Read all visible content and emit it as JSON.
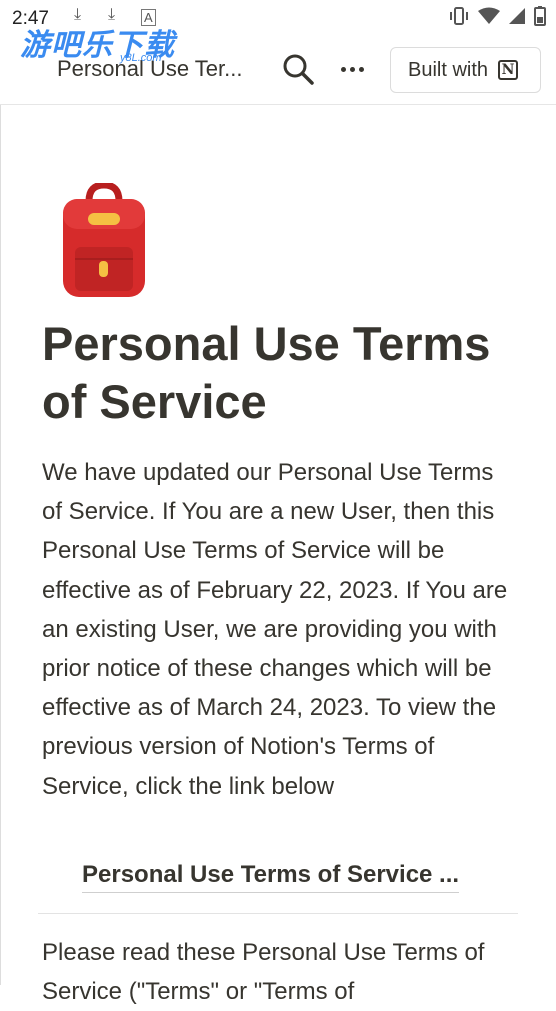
{
  "status": {
    "time": "2:47",
    "icons": [
      "download-icon",
      "download-icon",
      "a-icon",
      "vibrate-icon",
      "wifi-icon",
      "signal-icon",
      "battery-icon"
    ]
  },
  "watermark": {
    "text": "游吧乐下载",
    "sub": "y8L.com"
  },
  "topbar": {
    "title": "Personal Use Ter...",
    "built_with": "Built with",
    "logo_letter": "N"
  },
  "page": {
    "icon": "backpack-icon",
    "title": "Personal Use Terms of Service",
    "intro": "We have updated our Personal Use Terms of Service. If You are a new User, then this Personal Use Terms of Service will be effective as of February 22, 2023. If You are an existing User, we are providing you with prior notice of these changes which will be effective as of March 24, 2023. To view the previous version of Notion's Terms of Service, click the link below",
    "link": "Personal Use Terms of Service ...",
    "para2": "Please read these Personal Use Terms of Service (\"Terms\" or \"Terms of"
  },
  "colors": {
    "text": "#37352f",
    "watermark": "#3a8bf0",
    "backpack": "#d62b2b"
  }
}
